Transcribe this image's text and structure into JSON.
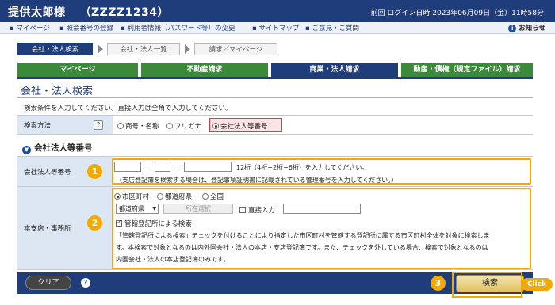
{
  "header": {
    "user_name": "提供太郎様",
    "user_id": "（ZZZZ1234）",
    "last_login": "前回 ログイン日時 2023年06月09日（金）11時58分"
  },
  "nav": {
    "links": [
      "▪ マイページ",
      "▪ 照会番号の登録",
      "▪ 利用者情報（パスワード等）の変更",
      "▪ サイトマップ",
      "▪ ご意見・ご質問"
    ],
    "notice": "お知らせ"
  },
  "steps": [
    "会社・法人検索",
    "会社・法人一覧",
    "請求／マイページ"
  ],
  "tabs": [
    "マイページ",
    "不動産請求",
    "商業・法人請求",
    "動産・債権（規定ファイル）請求"
  ],
  "active_tab": "商業・法人請求",
  "page_title": "会社・法人検索",
  "instruction": "検索条件を入力してください。直接入力は全角で入力してください。",
  "search_method": {
    "label": "検索方法",
    "help": "?",
    "options": [
      "商号・名称",
      "フリガナ",
      "会社法人等番号"
    ],
    "selected": "会社法人等番号"
  },
  "section_heading": "会社法人等番号",
  "corp_number": {
    "label": "会社法人等番号",
    "part1": "",
    "part2": "",
    "part3": "",
    "hint": "12桁（4桁−2桁−6桁）を入力してください。",
    "note": "（支店登記簿を検索する場合は、登記事項証明書に記載されている管理番号を入力してください。）"
  },
  "office": {
    "label": "本支店・事務所",
    "scope_options": [
      "市区町村",
      "都道府県",
      "全国"
    ],
    "scope_selected": "市区町村",
    "prefecture_select": "都道府県",
    "location_button": "所在選択",
    "direct_input_label": "直接入力",
    "direct_input_value": "",
    "jurisdiction_label": "管轄登記所による検索",
    "jurisdiction_checked": true,
    "desc_line1": "「管轄登記所による検索」チェックを付けることにより指定した市区町村を管轄する登記所に属する市区町村全体を対象に検索しま",
    "desc_line2": "す。本検索で対象となるのは内外国会社・法人の本店・支店登記簿です。また、チェックを外している場合、検索で対象となるのは",
    "desc_line3": "内国会社・法人の本店登記簿のみです。"
  },
  "buttons": {
    "clear": "クリア",
    "help": "?",
    "search": "検索"
  },
  "callouts": {
    "badge1": "1",
    "badge2": "2",
    "badge3": "3",
    "click": "Click"
  },
  "colors": {
    "navy": "#1f3d7a",
    "green_tab": "#3a8a3a",
    "highlight": "#f2a900",
    "label_bg": "#dde6f3"
  }
}
